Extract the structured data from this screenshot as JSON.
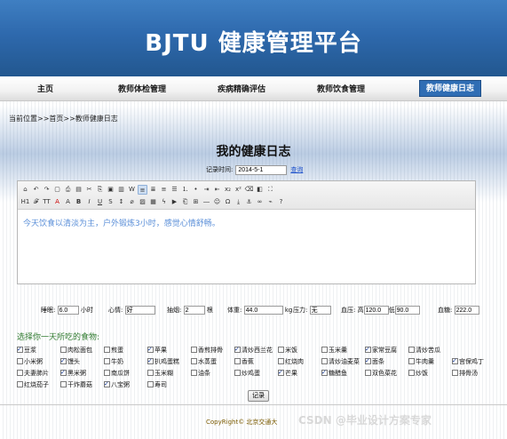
{
  "header": {
    "title": "BJTU 健康管理平台"
  },
  "nav": {
    "items": [
      {
        "label": "主页"
      },
      {
        "label": "教师体检管理"
      },
      {
        "label": "疾病精确评估"
      },
      {
        "label": "教师饮食管理"
      },
      {
        "label": "教师健康日志"
      }
    ]
  },
  "breadcrumb": {
    "text": "当前位置>>首页>>教师健康日志"
  },
  "page": {
    "title": "我的健康日志"
  },
  "record": {
    "time_label": "记录时间",
    "time_value": "2014-5-1",
    "query_label": "查询"
  },
  "editor": {
    "content": "今天饮食以清淡为主，户外锻炼3小时，感觉心情舒畅。",
    "toolbar_icons": [
      "source-icon",
      "undo-icon",
      "redo-icon",
      "preview-icon",
      "print-icon",
      "template-icon",
      "cut-icon",
      "copy-icon",
      "paste-icon",
      "paste-text-icon",
      "paste-word-icon",
      "align-left-icon",
      "align-center-icon",
      "align-right-icon",
      "justify-icon",
      "ordered-list-icon",
      "unordered-list-icon",
      "indent-icon",
      "outdent-icon",
      "subscript-icon",
      "superscript-icon",
      "clear-format-icon",
      "select-all-icon",
      "fullscreen-icon",
      "heading-icon",
      "font-family-icon",
      "font-size-icon",
      "font-color-icon",
      "bg-color-icon",
      "bold-icon",
      "italic-icon",
      "underline-icon",
      "strike-icon",
      "line-height-icon",
      "remove-format-icon",
      "image-icon",
      "multi-image-icon",
      "flash-icon",
      "media-icon",
      "insert-file-icon",
      "table-icon",
      "hr-icon",
      "emoticon-icon",
      "special-char-icon",
      "page-break-icon",
      "anchor-icon",
      "link-icon",
      "unlink-icon",
      "help-icon"
    ]
  },
  "metrics": [
    {
      "label": "睡眠:",
      "value": "6.0",
      "unit": "小时"
    },
    {
      "label": "心情:",
      "value": "好",
      "unit": ""
    },
    {
      "label": "抽烟:",
      "value": "2",
      "unit": "根"
    },
    {
      "label": "体重:",
      "value": "44.0",
      "unit": "kg"
    },
    {
      "label": "压力:",
      "value": "无",
      "unit": ""
    },
    {
      "label": "血压:",
      "value_high": "120.0",
      "value_low": "90.0",
      "high_label": "高",
      "low_label": "低"
    },
    {
      "label": "血糖:",
      "value": "222.0",
      "unit": ""
    }
  ],
  "food": {
    "title": "选择你一天所吃的食物:",
    "rows": [
      [
        {
          "name": "豆浆",
          "checked": true
        },
        {
          "name": "肉松面包",
          "checked": false
        },
        {
          "name": "煎蛋",
          "checked": false
        },
        {
          "name": "苹果",
          "checked": true
        },
        {
          "name": "香煎排骨",
          "checked": false
        },
        {
          "name": "清炒西兰花",
          "checked": true
        },
        {
          "name": "米饭",
          "checked": false
        },
        {
          "name": "玉米羹",
          "checked": false
        },
        {
          "name": "家常豆腐",
          "checked": true
        },
        {
          "name": "清炒苦瓜",
          "checked": false
        }
      ],
      [
        {
          "name": "小米粥",
          "checked": false
        },
        {
          "name": "馒头",
          "checked": true
        },
        {
          "name": "牛奶",
          "checked": false
        },
        {
          "name": "扒鸡蛋糕",
          "checked": true
        },
        {
          "name": "水蒸蛋",
          "checked": false
        },
        {
          "name": "香蕉",
          "checked": false
        },
        {
          "name": "红烧肉",
          "checked": false
        },
        {
          "name": "清炒油麦菜",
          "checked": false
        },
        {
          "name": "面条",
          "checked": true
        },
        {
          "name": "牛肉羹",
          "checked": false
        },
        {
          "name": "宫保鸡丁",
          "checked": true
        }
      ],
      [
        {
          "name": "夫妻肺片",
          "checked": false
        },
        {
          "name": "黑米粥",
          "checked": true
        },
        {
          "name": "南瓜饼",
          "checked": false
        },
        {
          "name": "玉米糊",
          "checked": false
        },
        {
          "name": "油条",
          "checked": false
        },
        {
          "name": "炒鸡蛋",
          "checked": false
        },
        {
          "name": "芒果",
          "checked": true
        },
        {
          "name": "糖醋鱼",
          "checked": true
        },
        {
          "name": "双色菜花",
          "checked": false
        },
        {
          "name": "炒饭",
          "checked": false
        },
        {
          "name": "排骨汤",
          "checked": false
        }
      ],
      [
        {
          "name": "红烧茄子",
          "checked": false
        },
        {
          "name": "干炸蘑菇",
          "checked": false
        },
        {
          "name": "八宝粥",
          "checked": true
        },
        {
          "name": "寿司",
          "checked": false
        }
      ]
    ]
  },
  "actions": {
    "submit_label": "记录"
  },
  "footer": {
    "copyright": "CopyRight© 北京交通大",
    "watermark": "CSDN @毕业设计方案专家"
  }
}
